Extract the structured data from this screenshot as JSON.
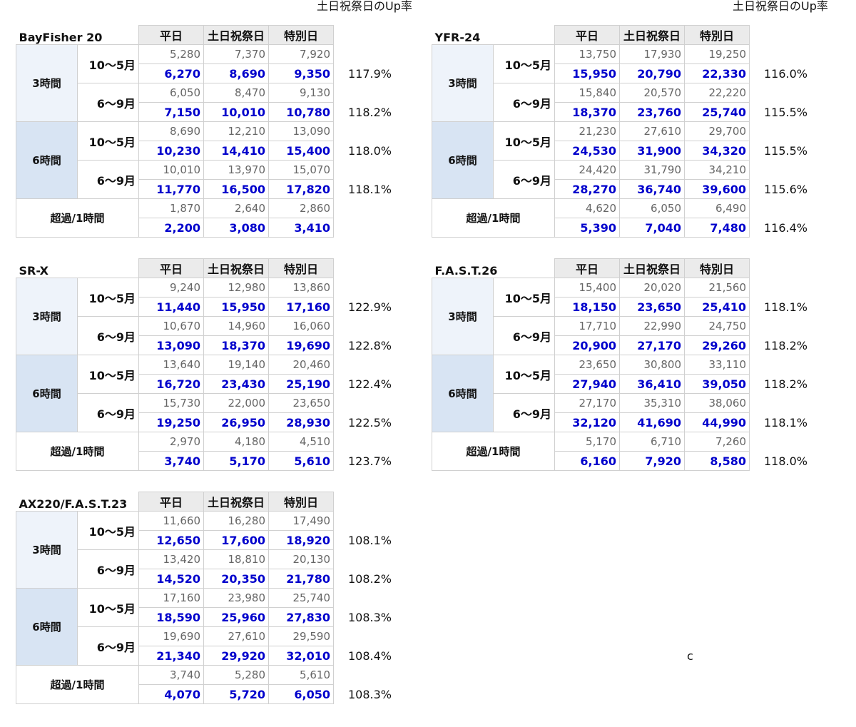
{
  "up_rate_label": "土日祝祭日のUp率",
  "stray_char": "c",
  "columns": [
    "平日",
    "土日祝祭日",
    "特別日"
  ],
  "tables": [
    {
      "title": "BayFisher 20",
      "show_up_label": true,
      "groups": [
        {
          "duration": "3時間",
          "periods": [
            {
              "period": "10〜5月",
              "old": [
                "5,280",
                "7,370",
                "7,920"
              ],
              "new": [
                "6,270",
                "8,690",
                "9,350"
              ],
              "up": "117.9%"
            },
            {
              "period": "6〜9月",
              "old": [
                "6,050",
                "8,470",
                "9,130"
              ],
              "new": [
                "7,150",
                "10,010",
                "10,780"
              ],
              "up": "118.2%"
            }
          ]
        },
        {
          "duration": "6時間",
          "periods": [
            {
              "period": "10〜5月",
              "old": [
                "8,690",
                "12,210",
                "13,090"
              ],
              "new": [
                "10,230",
                "14,410",
                "15,400"
              ],
              "up": "118.0%"
            },
            {
              "period": "6〜9月",
              "old": [
                "10,010",
                "13,970",
                "15,070"
              ],
              "new": [
                "11,770",
                "16,500",
                "17,820"
              ],
              "up": "118.1%"
            }
          ]
        }
      ],
      "overtime": {
        "label": "超過/1時間",
        "old": [
          "1,870",
          "2,640",
          "2,860"
        ],
        "new": [
          "2,200",
          "3,080",
          "3,410"
        ],
        "up": ""
      }
    },
    {
      "title": "YFR-24",
      "show_up_label": true,
      "groups": [
        {
          "duration": "3時間",
          "periods": [
            {
              "period": "10〜5月",
              "old": [
                "13,750",
                "17,930",
                "19,250"
              ],
              "new": [
                "15,950",
                "20,790",
                "22,330"
              ],
              "up": "116.0%"
            },
            {
              "period": "6〜9月",
              "old": [
                "15,840",
                "20,570",
                "22,220"
              ],
              "new": [
                "18,370",
                "23,760",
                "25,740"
              ],
              "up": "115.5%"
            }
          ]
        },
        {
          "duration": "6時間",
          "periods": [
            {
              "period": "10〜5月",
              "old": [
                "21,230",
                "27,610",
                "29,700"
              ],
              "new": [
                "24,530",
                "31,900",
                "34,320"
              ],
              "up": "115.5%"
            },
            {
              "period": "6〜9月",
              "old": [
                "24,420",
                "31,790",
                "34,210"
              ],
              "new": [
                "28,270",
                "36,740",
                "39,600"
              ],
              "up": "115.6%"
            }
          ]
        }
      ],
      "overtime": {
        "label": "超過/1時間",
        "old": [
          "4,620",
          "6,050",
          "6,490"
        ],
        "new": [
          "5,390",
          "7,040",
          "7,480"
        ],
        "up": "116.4%"
      }
    },
    {
      "title": "SR-X",
      "show_up_label": false,
      "groups": [
        {
          "duration": "3時間",
          "periods": [
            {
              "period": "10〜5月",
              "old": [
                "9,240",
                "12,980",
                "13,860"
              ],
              "new": [
                "11,440",
                "15,950",
                "17,160"
              ],
              "up": "122.9%"
            },
            {
              "period": "6〜9月",
              "old": [
                "10,670",
                "14,960",
                "16,060"
              ],
              "new": [
                "13,090",
                "18,370",
                "19,690"
              ],
              "up": "122.8%"
            }
          ]
        },
        {
          "duration": "6時間",
          "periods": [
            {
              "period": "10〜5月",
              "old": [
                "13,640",
                "19,140",
                "20,460"
              ],
              "new": [
                "16,720",
                "23,430",
                "25,190"
              ],
              "up": "122.4%"
            },
            {
              "period": "6〜9月",
              "old": [
                "15,730",
                "22,000",
                "23,650"
              ],
              "new": [
                "19,250",
                "26,950",
                "28,930"
              ],
              "up": "122.5%"
            }
          ]
        }
      ],
      "overtime": {
        "label": "超過/1時間",
        "old": [
          "2,970",
          "4,180",
          "4,510"
        ],
        "new": [
          "3,740",
          "5,170",
          "5,610"
        ],
        "up": "123.7%"
      }
    },
    {
      "title": "F.A.S.T.26",
      "show_up_label": false,
      "groups": [
        {
          "duration": "3時間",
          "periods": [
            {
              "period": "10〜5月",
              "old": [
                "15,400",
                "20,020",
                "21,560"
              ],
              "new": [
                "18,150",
                "23,650",
                "25,410"
              ],
              "up": "118.1%"
            },
            {
              "period": "6〜9月",
              "old": [
                "17,710",
                "22,990",
                "24,750"
              ],
              "new": [
                "20,900",
                "27,170",
                "29,260"
              ],
              "up": "118.2%"
            }
          ]
        },
        {
          "duration": "6時間",
          "periods": [
            {
              "period": "10〜5月",
              "old": [
                "23,650",
                "30,800",
                "33,110"
              ],
              "new": [
                "27,940",
                "36,410",
                "39,050"
              ],
              "up": "118.2%"
            },
            {
              "period": "6〜9月",
              "old": [
                "27,170",
                "35,310",
                "38,060"
              ],
              "new": [
                "32,120",
                "41,690",
                "44,990"
              ],
              "up": "118.1%"
            }
          ]
        }
      ],
      "overtime": {
        "label": "超過/1時間",
        "old": [
          "5,170",
          "6,710",
          "7,260"
        ],
        "new": [
          "6,160",
          "7,920",
          "8,580"
        ],
        "up": "118.0%"
      }
    },
    {
      "title": "AX220/F.A.S.T.23",
      "show_up_label": false,
      "groups": [
        {
          "duration": "3時間",
          "periods": [
            {
              "period": "10〜5月",
              "old": [
                "11,660",
                "16,280",
                "17,490"
              ],
              "new": [
                "12,650",
                "17,600",
                "18,920"
              ],
              "up": "108.1%"
            },
            {
              "period": "6〜9月",
              "old": [
                "13,420",
                "18,810",
                "20,130"
              ],
              "new": [
                "14,520",
                "20,350",
                "21,780"
              ],
              "up": "108.2%"
            }
          ]
        },
        {
          "duration": "6時間",
          "periods": [
            {
              "period": "10〜5月",
              "old": [
                "17,160",
                "23,980",
                "25,740"
              ],
              "new": [
                "18,590",
                "25,960",
                "27,830"
              ],
              "up": "108.3%"
            },
            {
              "period": "6〜9月",
              "old": [
                "19,690",
                "27,610",
                "29,590"
              ],
              "new": [
                "21,340",
                "29,920",
                "32,010"
              ],
              "up": "108.4%"
            }
          ]
        }
      ],
      "overtime": {
        "label": "超過/1時間",
        "old": [
          "3,740",
          "5,280",
          "5,610"
        ],
        "new": [
          "4,070",
          "5,720",
          "6,050"
        ],
        "up": "108.3%"
      }
    }
  ]
}
